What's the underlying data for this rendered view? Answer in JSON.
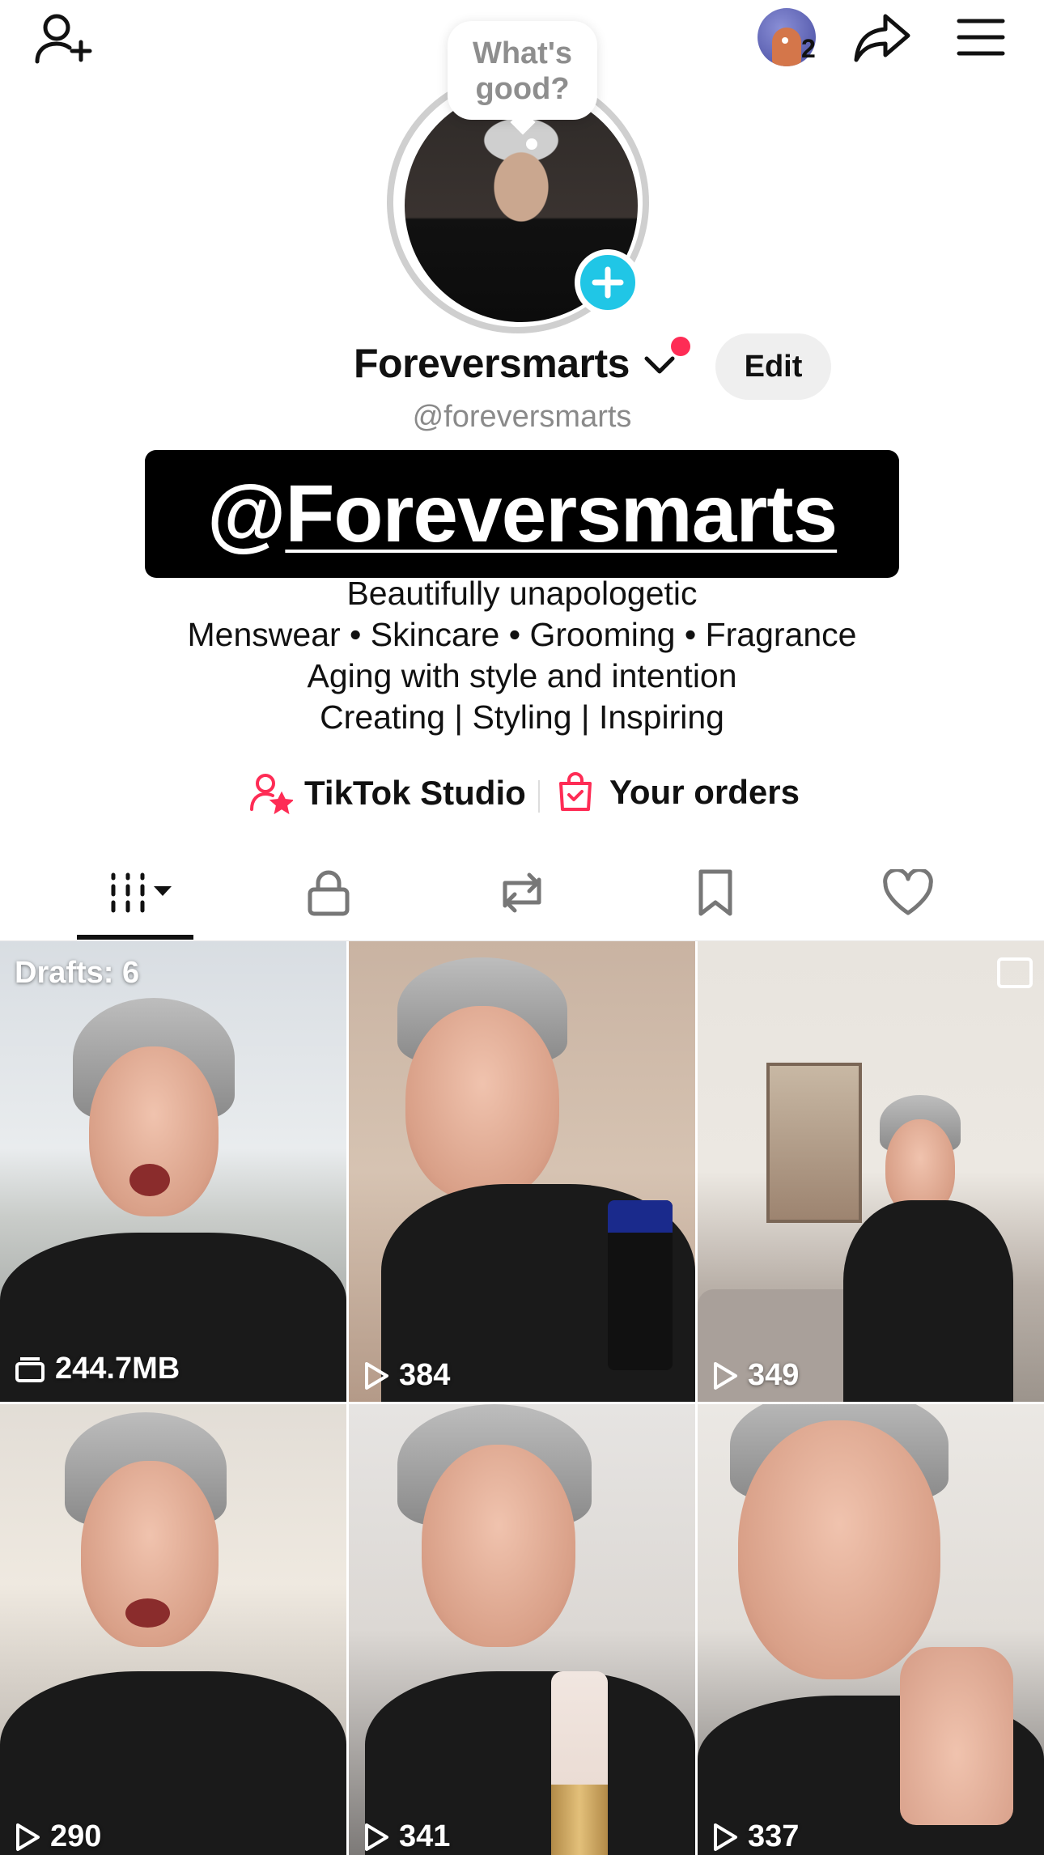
{
  "header": {
    "story_count": "2",
    "bubble_text": "What's good?"
  },
  "profile": {
    "display_name": "Foreversmarts",
    "edit_label": "Edit",
    "handle": "@foreversmarts",
    "banner_at": "@",
    "banner_rest": "Foreversmarts",
    "bio": [
      "Beautifully unapologetic",
      "Menswear • Skincare • Grooming • Fragrance",
      "Aging with style and intention",
      "Creating | Styling | Inspiring"
    ]
  },
  "links": {
    "studio_label": "TikTok Studio",
    "orders_label": "Your orders"
  },
  "tabs": [
    "videos",
    "private",
    "reposts",
    "favorites",
    "liked"
  ],
  "grid": [
    {
      "label": "Drafts: 6",
      "stat": "244.7MB",
      "stat_icon": "drafts-icon"
    },
    {
      "stat": "384",
      "stat_icon": "play-icon"
    },
    {
      "stat": "349",
      "stat_icon": "play-icon"
    },
    {
      "stat": "290",
      "stat_icon": "play-icon"
    },
    {
      "stat": "341",
      "stat_icon": "play-icon"
    },
    {
      "stat": "337",
      "stat_icon": "play-icon"
    }
  ],
  "colors": {
    "accent_red": "#fe2c55",
    "plus_blue": "#20c6e6"
  }
}
